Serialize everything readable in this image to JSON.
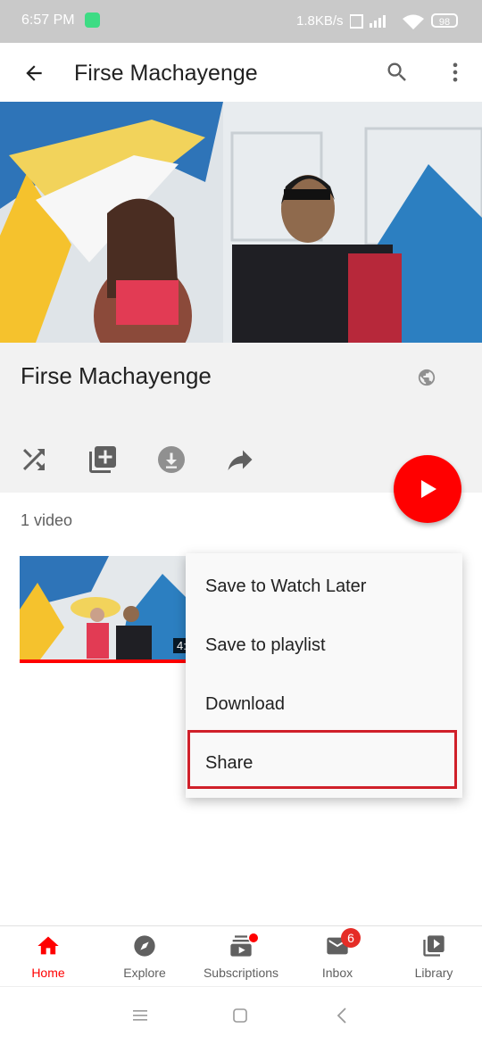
{
  "status_bar": {
    "time": "6:57 PM",
    "speed": "1.8KB/s",
    "battery": "98"
  },
  "app_bar": {
    "title": "Firse Machayenge"
  },
  "playlist": {
    "title": "Firse Machayenge",
    "video_count": "1 video"
  },
  "video": {
    "duration_partial": "4:"
  },
  "context_menu": {
    "items": [
      {
        "label": "Save to Watch Later"
      },
      {
        "label": "Save to playlist"
      },
      {
        "label": "Download"
      },
      {
        "label": "Share"
      }
    ],
    "highlighted": "Share"
  },
  "bottom_nav": {
    "items": [
      {
        "label": "Home",
        "active": true
      },
      {
        "label": "Explore"
      },
      {
        "label": "Subscriptions"
      },
      {
        "label": "Inbox",
        "badge": "6"
      },
      {
        "label": "Library"
      }
    ]
  },
  "colors": {
    "accent": "#ff0000",
    "highlight_border": "#d0202a"
  }
}
